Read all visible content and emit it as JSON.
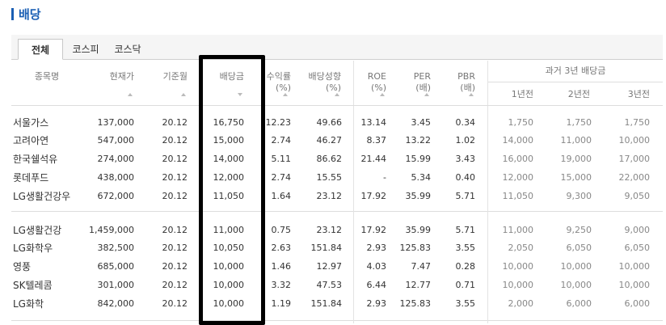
{
  "title": "배당",
  "tabs": [
    "전체",
    "코스피",
    "코스닥"
  ],
  "columns": {
    "name": "종목명",
    "price": "현재가",
    "base_month": "기준월",
    "dividend": "배당금",
    "yield_line1": "수익률",
    "yield_line2": "(%)",
    "payout_line1": "배당성향",
    "payout_line2": "(%)",
    "roe_line1": "ROE",
    "roe_line2": "(%)",
    "per_line1": "PER",
    "per_line2": "(배)",
    "pbr_line1": "PBR",
    "pbr_line2": "(배)",
    "past_group": "과거 3년 배당금",
    "past1": "1년전",
    "past2": "2년전",
    "past3": "3년전"
  },
  "rows": [
    {
      "name": "서울가스",
      "price": "137,000",
      "month": "20.12",
      "dividend": "16,750",
      "yield": "12.23",
      "payout": "49.66",
      "roe": "13.14",
      "per": "3.45",
      "pbr": "0.34",
      "y1": "1,750",
      "y2": "1,750",
      "y3": "1,750"
    },
    {
      "name": "고려아연",
      "price": "547,000",
      "month": "20.12",
      "dividend": "15,000",
      "yield": "2.74",
      "payout": "46.27",
      "roe": "8.37",
      "per": "13.22",
      "pbr": "1.02",
      "y1": "14,000",
      "y2": "11,000",
      "y3": "10,000"
    },
    {
      "name": "한국쉘석유",
      "price": "274,000",
      "month": "20.12",
      "dividend": "14,000",
      "yield": "5.11",
      "payout": "86.62",
      "roe": "21.44",
      "per": "15.99",
      "pbr": "3.43",
      "y1": "16,000",
      "y2": "19,000",
      "y3": "17,000"
    },
    {
      "name": "롯데푸드",
      "price": "438,000",
      "month": "20.12",
      "dividend": "12,000",
      "yield": "2.74",
      "payout": "15.55",
      "roe": "-",
      "per": "5.34",
      "pbr": "0.40",
      "y1": "12,000",
      "y2": "15,000",
      "y3": "22,000"
    },
    {
      "name": "LG생활건강우",
      "price": "672,000",
      "month": "20.12",
      "dividend": "11,050",
      "yield": "1.64",
      "payout": "23.12",
      "roe": "17.92",
      "per": "35.99",
      "pbr": "5.71",
      "y1": "11,050",
      "y2": "9,300",
      "y3": "9,050"
    },
    {
      "name": "LG생활건강",
      "price": "1,459,000",
      "month": "20.12",
      "dividend": "11,000",
      "yield": "0.75",
      "payout": "23.12",
      "roe": "17.92",
      "per": "35.99",
      "pbr": "5.71",
      "y1": "11,000",
      "y2": "9,250",
      "y3": "9,000"
    },
    {
      "name": "LG화학우",
      "price": "382,500",
      "month": "20.12",
      "dividend": "10,050",
      "yield": "2.63",
      "payout": "151.84",
      "roe": "2.93",
      "per": "125.83",
      "pbr": "3.55",
      "y1": "2,050",
      "y2": "6,050",
      "y3": "6,050"
    },
    {
      "name": "영풍",
      "price": "685,000",
      "month": "20.12",
      "dividend": "10,000",
      "yield": "1.46",
      "payout": "12.97",
      "roe": "4.03",
      "per": "7.47",
      "pbr": "0.28",
      "y1": "10,000",
      "y2": "10,000",
      "y3": "10,000"
    },
    {
      "name": "SK텔레콤",
      "price": "301,000",
      "month": "20.12",
      "dividend": "10,000",
      "yield": "3.32",
      "payout": "47.53",
      "roe": "6.44",
      "per": "12.77",
      "pbr": "0.71",
      "y1": "10,000",
      "y2": "10,000",
      "y3": "10,000"
    },
    {
      "name": "LG화학",
      "price": "842,000",
      "month": "20.12",
      "dividend": "10,000",
      "yield": "1.19",
      "payout": "151.84",
      "roe": "2.93",
      "per": "125.83",
      "pbr": "3.55",
      "y1": "2,000",
      "y2": "6,000",
      "y3": "6,000"
    }
  ]
}
